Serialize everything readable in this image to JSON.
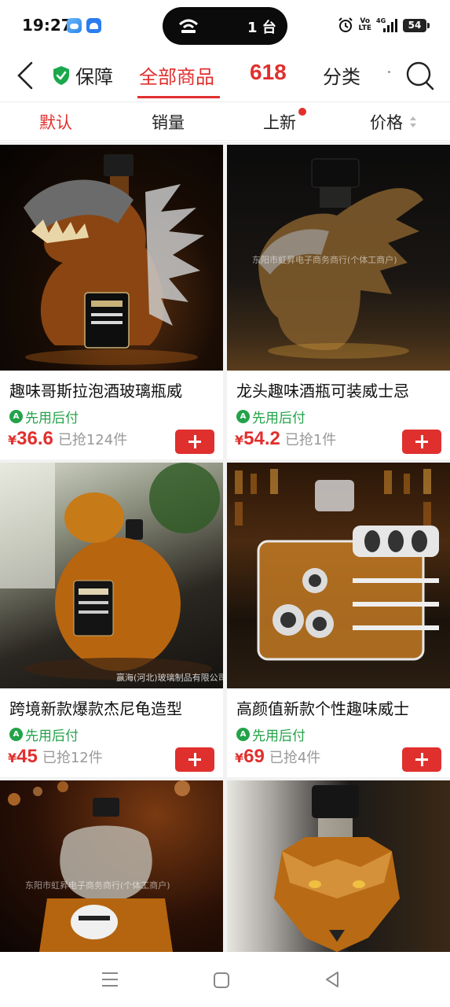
{
  "status": {
    "time": "19:27",
    "pill_text": "1 台",
    "volte_top": "Vo",
    "volte_bottom": "LTE",
    "network": "4G",
    "battery": "54"
  },
  "nav": {
    "guarantee_label": "保障",
    "tab_all": "全部商品",
    "tab_618": "618",
    "tab_category": "分类"
  },
  "sort": {
    "default": "默认",
    "sales": "销量",
    "new": "上新",
    "price": "价格"
  },
  "products": [
    {
      "title": "趣味哥斯拉泡酒玻璃瓶威",
      "pay": "先用后付",
      "price": "36.6",
      "sold": "已抢124件",
      "watermark": ""
    },
    {
      "title": "龙头趣味酒瓶可装威士忌",
      "pay": "先用后付",
      "price": "54.2",
      "sold": "已抢1件",
      "watermark": "东阳市虹昇电子商务商行(个体工商户)"
    },
    {
      "title": "跨境新款爆款杰尼龟造型",
      "pay": "先用后付",
      "price": "45",
      "sold": "已抢12件",
      "watermark": "赢海(河北)玻璃制品有限公司"
    },
    {
      "title": "高颜值新款个性趣味威士",
      "pay": "先用后付",
      "price": "69",
      "sold": "已抢4件",
      "watermark": ""
    },
    {
      "title": "",
      "pay": "",
      "price": "",
      "sold": "",
      "watermark": "东阳市虹昇电子商务商行(个体工商户)"
    },
    {
      "title": "",
      "pay": "",
      "price": "",
      "sold": "",
      "watermark": ""
    }
  ],
  "currency_symbol": "¥",
  "icons": {
    "back": "back-arrow-icon",
    "guarantee": "shield-check-icon",
    "search": "search-icon",
    "pay": "pay-later-icon",
    "add": "plus-icon"
  },
  "colors": {
    "accent": "#e0302e",
    "pay_green": "#23a349"
  }
}
